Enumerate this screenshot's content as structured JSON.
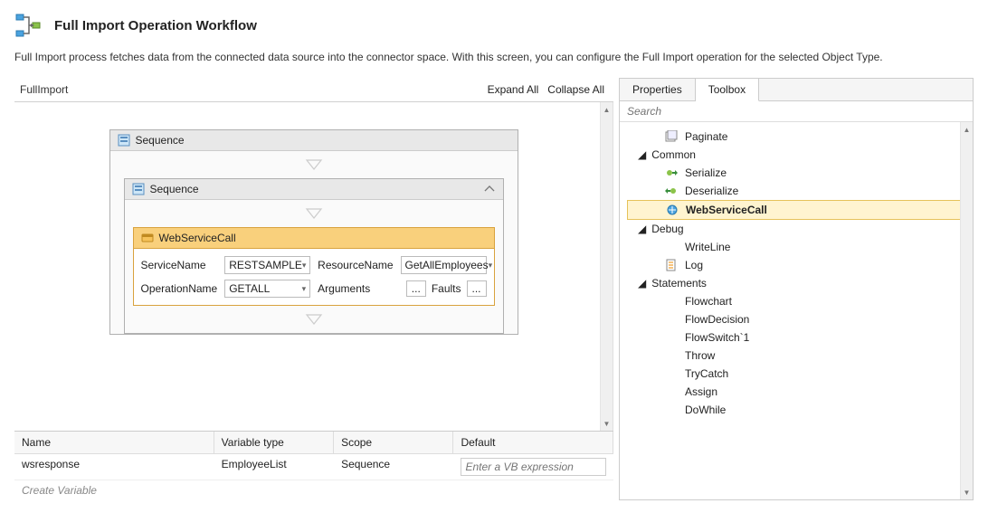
{
  "header": {
    "title": "Full Import Operation Workflow",
    "description": "Full Import process fetches data from the connected data source into the connector space. With this screen, you can configure the Full Import operation for the selected Object Type."
  },
  "designer": {
    "breadcrumb": "FullImport",
    "expand_all": "Expand All",
    "collapse_all": "Collapse All",
    "outer_sequence": "Sequence",
    "inner_sequence": "Sequence",
    "wscall": {
      "title": "WebServiceCall",
      "servicename_label": "ServiceName",
      "servicename_value": "RESTSAMPLE",
      "resourcename_label": "ResourceName",
      "resourcename_value": "GetAllEmployees",
      "operationname_label": "OperationName",
      "operationname_value": "GETALL",
      "arguments_label": "Arguments",
      "faults_label": "Faults"
    }
  },
  "variables": {
    "columns": {
      "name": "Name",
      "type": "Variable type",
      "scope": "Scope",
      "default": "Default"
    },
    "rows": [
      {
        "name": "wsresponse",
        "type": "EmployeeList",
        "scope": "Sequence",
        "default_placeholder": "Enter a VB expression"
      }
    ],
    "create_label": "Create Variable"
  },
  "right": {
    "tabs": {
      "properties": "Properties",
      "toolbox": "Toolbox"
    },
    "search_placeholder": "Search",
    "tree": {
      "paginate": "Paginate",
      "common": "Common",
      "serialize": "Serialize",
      "deserialize": "Deserialize",
      "webservicecall": "WebServiceCall",
      "debug": "Debug",
      "writeline": "WriteLine",
      "log": "Log",
      "statements": "Statements",
      "flowchart": "Flowchart",
      "flowdecision": "FlowDecision",
      "flowswitch": "FlowSwitch`1",
      "throw": "Throw",
      "trycatch": "TryCatch",
      "assign": "Assign",
      "dowhile": "DoWhile"
    }
  }
}
